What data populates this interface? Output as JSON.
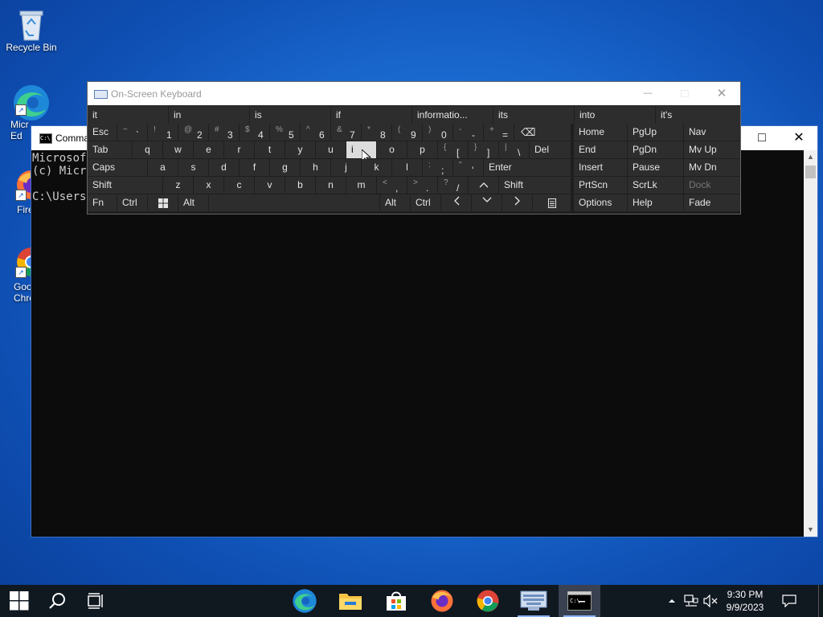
{
  "desktop": {
    "icons": [
      {
        "label": "Recycle Bin"
      },
      {
        "label": "Micr Ed"
      },
      {
        "label": "Fire"
      },
      {
        "label": "Goo Chro"
      }
    ]
  },
  "cmd": {
    "title": "Comma",
    "lines": "Microsoft\n(c) Micro\n\nC:\\Users\\",
    "controls": {
      "maximize": "□",
      "close": "✕"
    }
  },
  "osk": {
    "title": "On-Screen Keyboard",
    "controls": {
      "minimize": "—",
      "maximize": "□",
      "close": "✕"
    },
    "predictions": [
      "it",
      "in",
      "is",
      "if",
      "informatio...",
      "its",
      "into",
      "it's"
    ],
    "row1": {
      "esc": "Esc",
      "keys": [
        {
          "shift": "~",
          "primary": "`"
        },
        {
          "shift": "!",
          "primary": "1"
        },
        {
          "shift": "@",
          "primary": "2"
        },
        {
          "shift": "#",
          "primary": "3"
        },
        {
          "shift": "$",
          "primary": "4"
        },
        {
          "shift": "%",
          "primary": "5"
        },
        {
          "shift": "^",
          "primary": "6"
        },
        {
          "shift": "&",
          "primary": "7"
        },
        {
          "shift": "*",
          "primary": "8"
        },
        {
          "shift": "(",
          "primary": "9"
        },
        {
          "shift": ")",
          "primary": "0"
        },
        {
          "shift": "-",
          "primary": "-"
        },
        {
          "shift": "+",
          "primary": "="
        }
      ],
      "backspace": "⌫"
    },
    "row2": {
      "tab": "Tab",
      "keys": [
        "q",
        "w",
        "e",
        "r",
        "t",
        "y",
        "u",
        "i",
        "o",
        "p"
      ],
      "brace_open": {
        "shift": "{",
        "primary": "["
      },
      "brace_close": {
        "shift": "}",
        "primary": "]"
      },
      "pipe": {
        "shift": "|",
        "primary": "\\"
      },
      "del": "Del"
    },
    "row3": {
      "caps": "Caps",
      "keys": [
        "a",
        "s",
        "d",
        "f",
        "g",
        "h",
        "j",
        "k",
        "l"
      ],
      "semi": {
        "shift": ":",
        "primary": ";"
      },
      "quote": {
        "shift": "\"",
        "primary": "'"
      },
      "enter": "Enter"
    },
    "row4": {
      "shift_left": "Shift",
      "keys": [
        "z",
        "x",
        "c",
        "v",
        "b",
        "n",
        "m"
      ],
      "comma": {
        "shift": "<",
        "primary": ","
      },
      "period": {
        "shift": ">",
        "primary": "."
      },
      "slash": {
        "shift": "?",
        "primary": "/"
      },
      "up": "^",
      "shift_right": "Shift"
    },
    "row5": {
      "fn": "Fn",
      "ctrl": "Ctrl",
      "alt": "Alt",
      "alt_right": "Alt",
      "ctrl_right": "Ctrl",
      "left": "<",
      "down": "v",
      "right": ">"
    },
    "nav": {
      "home": "Home",
      "pgup": "PgUp",
      "nav": "Nav",
      "end": "End",
      "pgdn": "PgDn",
      "mvup": "Mv Up",
      "insert": "Insert",
      "pause": "Pause",
      "mvdn": "Mv Dn",
      "prtscn": "PrtScn",
      "scrlk": "ScrLk",
      "dock": "Dock",
      "options": "Options",
      "help": "Help",
      "fade": "Fade"
    },
    "highlighted_key": "i"
  },
  "taskbar": {
    "clock_time": "9:30 PM",
    "clock_date": "9/9/2023"
  }
}
